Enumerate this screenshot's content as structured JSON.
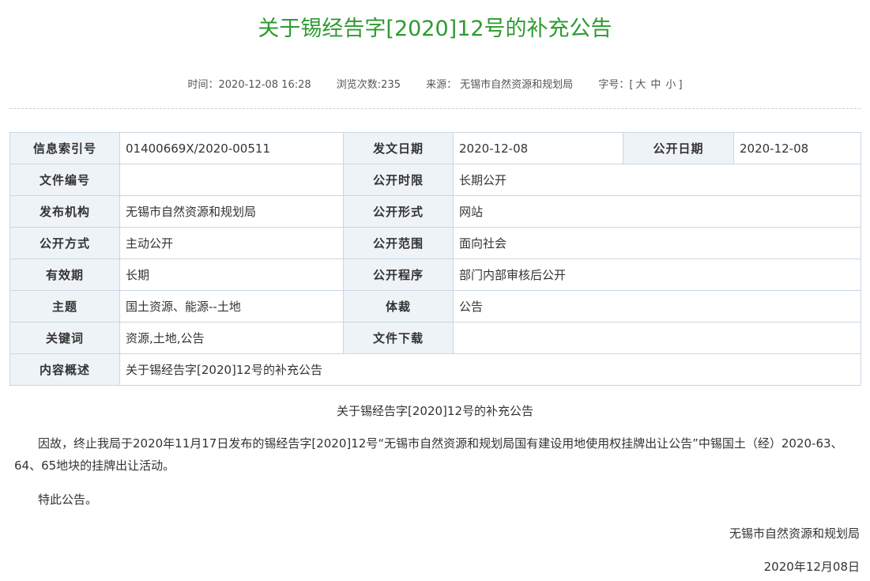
{
  "title": "关于锡经告字[2020]12号的补充公告",
  "meta": {
    "time_label": "时间：",
    "time": "2020-12-08 16:28",
    "views": "浏览次数:235",
    "source_label": "来源：",
    "source": "无锡市自然资源和规划局",
    "font_size_label": "字号：[",
    "font_large": "大",
    "font_medium": "中",
    "font_small": "小",
    "font_size_close": "]"
  },
  "info_table": {
    "rows": [
      [
        {
          "label": "信息索引号",
          "value": "01400669X/2020-00511"
        },
        {
          "label": "发文日期",
          "value": "2020-12-08"
        },
        {
          "label": "公开日期",
          "value": "2020-12-08"
        }
      ],
      [
        {
          "label": "文件编号",
          "value": ""
        },
        {
          "label": "公开时限",
          "value": "长期公开"
        }
      ],
      [
        {
          "label": "发布机构",
          "value": "无锡市自然资源和规划局"
        },
        {
          "label": "公开形式",
          "value": "网站"
        }
      ],
      [
        {
          "label": "公开方式",
          "value": "主动公开"
        },
        {
          "label": "公开范围",
          "value": "面向社会"
        }
      ],
      [
        {
          "label": "有效期",
          "value": "长期"
        },
        {
          "label": "公开程序",
          "value": "部门内部审核后公开"
        }
      ],
      [
        {
          "label": "主题",
          "value": "国土资源、能源--土地"
        },
        {
          "label": "体裁",
          "value": "公告"
        }
      ],
      [
        {
          "label": "关键词",
          "value": "资源,土地,公告"
        },
        {
          "label": "文件下载",
          "value": ""
        }
      ],
      [
        {
          "label": "内容概述",
          "value": "关于锡经告字[2020]12号的补充公告"
        }
      ]
    ]
  },
  "body": {
    "title": "关于锡经告字[2020]12号的补充公告",
    "paragraph1": "因故，终止我局于2020年11月17日发布的锡经告字[2020]12号“无锡市自然资源和规划局国有建设用地使用权挂牌出让公告”中锡国土（经）2020-63、64、65地块的挂牌出让活动。",
    "paragraph2": "特此公告。",
    "signature": "无锡市自然资源和规划局",
    "date": "2020年12月08日"
  },
  "colors": {
    "title": "#2e9a31",
    "label_bg": "#eef3f8",
    "border": "#c9d6e3"
  }
}
